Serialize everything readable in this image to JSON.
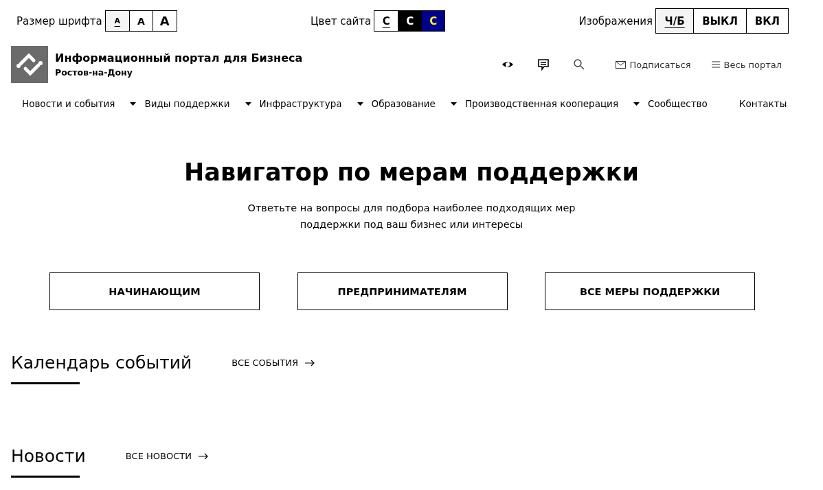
{
  "accessibility_bar": {
    "font_size": {
      "label": "Размер шрифта",
      "options": [
        {
          "text": "A",
          "kind": "small",
          "selected": true
        },
        {
          "text": "A",
          "kind": "medium",
          "selected": false
        },
        {
          "text": "A",
          "kind": "large",
          "selected": false
        }
      ]
    },
    "site_color": {
      "label": "Цвет сайта",
      "options": [
        {
          "text": "C",
          "kind": "white",
          "selected": true
        },
        {
          "text": "C",
          "kind": "black",
          "selected": false
        },
        {
          "text": "C",
          "kind": "blue",
          "selected": false
        }
      ]
    },
    "images": {
      "label": "Изображения",
      "options": [
        {
          "text": "Ч/Б",
          "selected": true
        },
        {
          "text": "ВЫКЛ",
          "selected": false
        },
        {
          "text": "ВКЛ",
          "selected": false
        }
      ]
    }
  },
  "header": {
    "title": "Информационный портал для Бизнеса",
    "subtitle": "Ростов-на-Дону",
    "subscribe": "Подписаться",
    "all_portal": "Весь портал"
  },
  "nav": [
    {
      "label": "Новости и события",
      "dropdown": true
    },
    {
      "label": "Виды поддержки",
      "dropdown": true
    },
    {
      "label": "Инфраструктура",
      "dropdown": true
    },
    {
      "label": "Образование",
      "dropdown": true
    },
    {
      "label": "Производственная кооперация",
      "dropdown": true
    },
    {
      "label": "Сообщество",
      "dropdown": false
    },
    {
      "label": "Контакты",
      "dropdown": false
    }
  ],
  "hero": {
    "title": "Навигатор по мерам поддержки",
    "subtitle": "Ответьте на вопросы для подбора наиболее подходящих мер поддержки под ваш бизнес или интересы",
    "buttons": [
      "НАЧИНАЮЩИМ",
      "ПРЕДПРИНИМАТЕЛЯМ",
      "ВСЕ МЕРЫ ПОДДЕРЖКИ"
    ]
  },
  "sections": [
    {
      "title": "Календарь событий",
      "link": "ВСЕ СОБЫТИЯ"
    },
    {
      "title": "Новости",
      "link": "ВСЕ НОВОСТИ"
    }
  ]
}
